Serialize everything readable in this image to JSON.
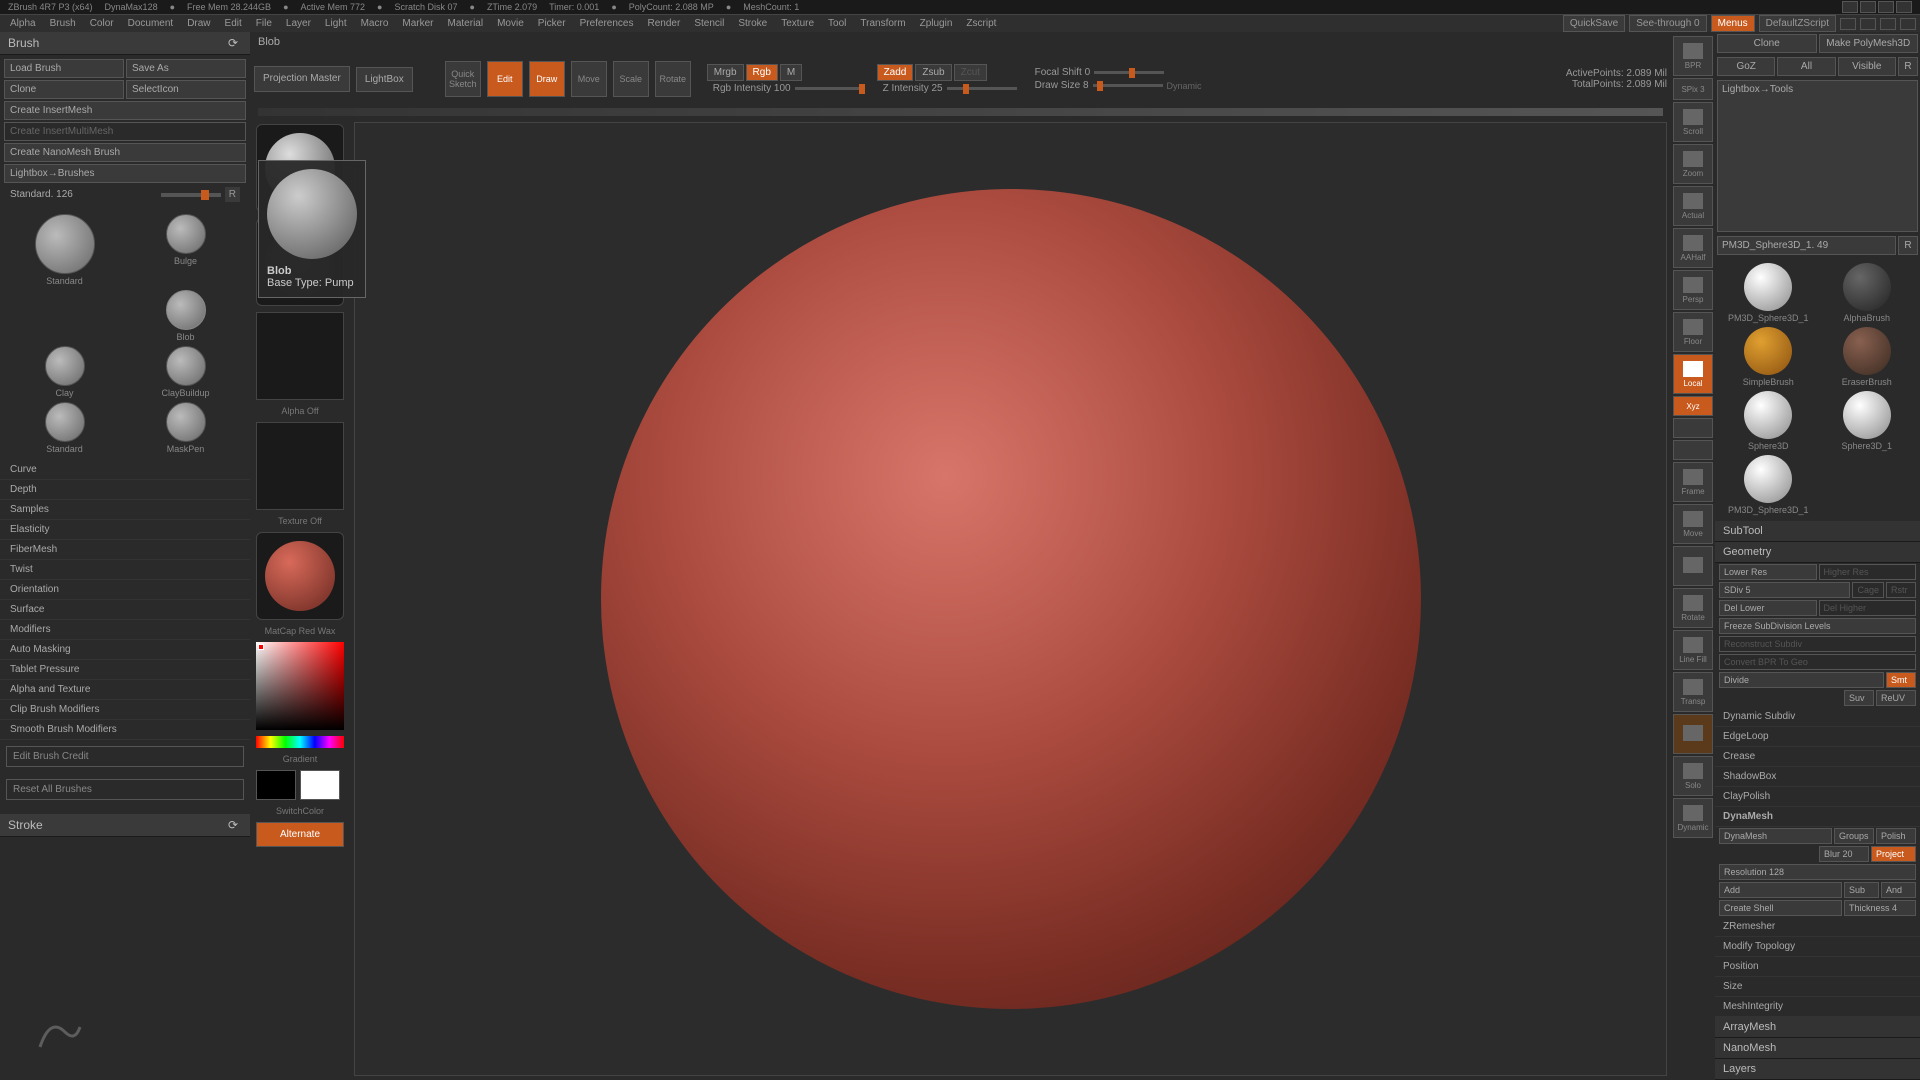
{
  "titlebar": {
    "app": "ZBrush 4R7 P3 (x64)",
    "dynamesh": "DynaMax128",
    "freemem": "Free Mem 28.244GB",
    "activemem": "Active Mem 772",
    "scratch": "Scratch Disk 07",
    "ztime": "ZTime 2.079",
    "timer": "Timer: 0.001",
    "polycount": "PolyCount: 2.088 MP",
    "meshcount": "MeshCount: 1"
  },
  "menubar": {
    "items": [
      "Alpha",
      "Brush",
      "Color",
      "Document",
      "Draw",
      "Edit",
      "File",
      "Layer",
      "Light",
      "Macro",
      "Marker",
      "Material",
      "Movie",
      "Picker",
      "Preferences",
      "Render",
      "Stencil",
      "Stroke",
      "Texture",
      "Tool",
      "Transform",
      "Zplugin",
      "Zscript"
    ],
    "quicksave": "QuickSave",
    "seethrough": "See-through 0",
    "menus": "Menus",
    "defaultscript": "DefaultZScript"
  },
  "leftpanel": {
    "title": "Brush",
    "load": "Load Brush",
    "saveas": "Save As",
    "clone": "Clone",
    "selecticon": "SelectIcon",
    "createinsert": "Create InsertMesh",
    "createinsertmulti": "Create InsertMultiMesh",
    "createnano": "Create NanoMesh Brush",
    "lightboxbrushes": "Lightbox→Brushes",
    "standardsize": "Standard. 126",
    "r": "R",
    "brushes": {
      "standard": "Standard",
      "bulge": "Bulge",
      "blob": "Blob",
      "clay": "Clay",
      "claybuildup": "ClayBuildup",
      "maskpen": "MaskPen"
    },
    "sections": [
      "Curve",
      "Depth",
      "Samples",
      "Elasticity",
      "FiberMesh",
      "Twist",
      "Orientation",
      "Surface",
      "Modifiers",
      "Auto Masking",
      "Tablet Pressure",
      "Alpha and Texture",
      "Clip Brush Modifiers",
      "Smooth Brush Modifiers"
    ],
    "editcredit": "Edit Brush Credit",
    "resetall": "Reset All Brushes",
    "stroke": "Stroke"
  },
  "topbar": {
    "blob": "Blob",
    "projmaster": "Projection Master",
    "lightbox": "LightBox",
    "quicksketch": "Quick Sketch",
    "edit": "Edit",
    "draw": "Draw",
    "move": "Move",
    "scale": "Scale",
    "rotate": "Rotate",
    "mrgb": "Mrgb",
    "rgb": "Rgb",
    "m": "M",
    "rgbintensity": "Rgb Intensity 100",
    "zadd": "Zadd",
    "zsub": "Zsub",
    "zcut": "Zcut",
    "zintensity": "Z Intensity 25",
    "focalshift": "Focal Shift 0",
    "drawsize": "Draw Size 8",
    "dynamic": "Dynamic",
    "activepoints": "ActivePoints: 2.089 Mil",
    "totalpoints": "TotalPoints: 2.089 Mil"
  },
  "palette": {
    "alphaoff": "Alpha Off",
    "textureoff": "Texture Off",
    "matcap": "MatCap Red Wax",
    "gradient": "Gradient",
    "switchcolor": "SwitchColor",
    "alternate": "Alternate"
  },
  "tooltip": {
    "name": "Blob",
    "basetype": "Base Type: Pump"
  },
  "rightstrip": {
    "items": [
      "BPR",
      "SPix 3",
      "Scroll",
      "Zoom",
      "Actual",
      "AAHalf",
      "Persp",
      "Floor",
      "Local",
      "Xyz",
      "",
      "",
      "Frame",
      "Move",
      "",
      "Rotate",
      "Line Fill",
      "Transp",
      "",
      "Solo",
      "Dynamic"
    ]
  },
  "rightpanel": {
    "clone": "Clone",
    "makepolymesh": "Make PolyMesh3D",
    "goz": "GoZ",
    "all": "All",
    "visible": "Visible",
    "r": "R",
    "lightboxtools": "Lightbox→Tools",
    "toolname": "PM3D_Sphere3D_1. 49",
    "tools": {
      "pm3d": "PM3D_Sphere3D_1",
      "alphabrush": "AlphaBrush",
      "simplebrush": "SimpleBrush",
      "eraserbrush": "EraserBrush",
      "sphere3d": "Sphere3D",
      "sphere3d1": "Sphere3D_1",
      "pm3d2": "PM3D_Sphere3D_1"
    },
    "subtool": "SubTool",
    "geometry": "Geometry",
    "lowerres": "Lower Res",
    "higherres": "Higher Res",
    "sdiv": "SDiv 5",
    "cage": "Cage",
    "rstr": "Rstr",
    "dellower": "Del Lower",
    "delhigher": "Del Higher",
    "freezesub": "Freeze SubDivision Levels",
    "reconstruct": "Reconstruct Subdiv",
    "convertbpr": "Convert BPR To Geo",
    "divide": "Divide",
    "smt": "Smt",
    "suv": "Suv",
    "reuv": "ReUV",
    "dynamicsub": "Dynamic Subdiv",
    "edgeloop": "EdgeLoop",
    "crease": "Crease",
    "shadowbox": "ShadowBox",
    "claypolish": "ClayPolish",
    "dynamesh": "DynaMesh",
    "dynameshbtn": "DynaMesh",
    "groups": "Groups",
    "polish": "Polish",
    "blur": "Blur 20",
    "project": "Project",
    "resolution": "Resolution 128",
    "add": "Add",
    "sub": "Sub",
    "and": "And",
    "createshell": "Create Shell",
    "thickness": "Thickness 4",
    "zremesher": "ZRemesher",
    "modifytopo": "Modify Topology",
    "position": "Position",
    "size": "Size",
    "meshintegrity": "MeshIntegrity",
    "arraymesh": "ArrayMesh",
    "nanomesh": "NanoMesh",
    "layers": "Layers"
  }
}
